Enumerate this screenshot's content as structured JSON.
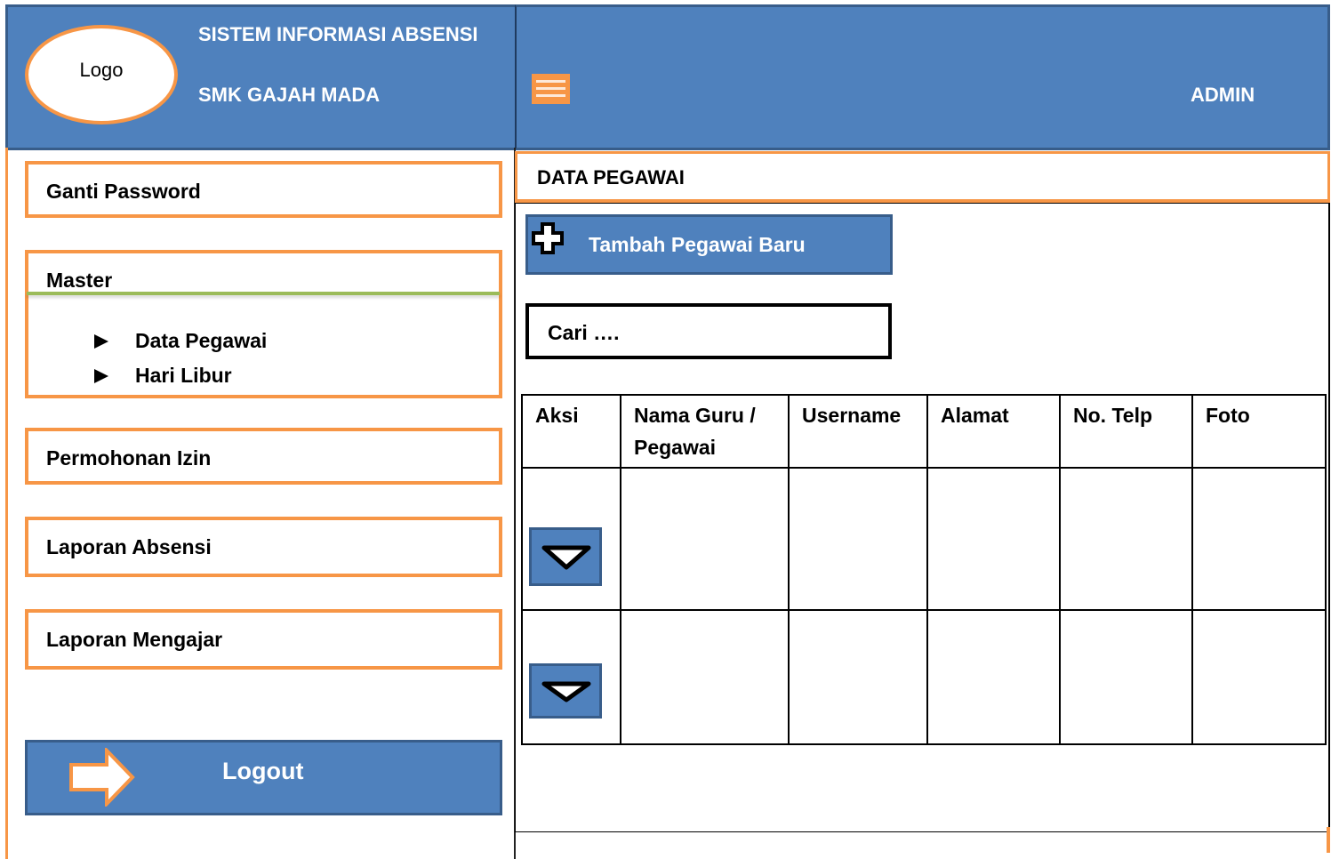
{
  "header": {
    "logo_text": "Logo",
    "system_title": "SISTEM INFORMASI ABSENSI",
    "school_name": "SMK GAJAH MADA",
    "menu_icon": "hamburger-icon",
    "user_label": "ADMIN"
  },
  "sidebar": {
    "ganti_password": "Ganti Password",
    "master": {
      "label": "Master",
      "items": [
        "Data Pegawai",
        "Hari Libur"
      ]
    },
    "permohonan_izin": "Permohonan Izin",
    "laporan_absensi": "Laporan Absensi",
    "laporan_mengajar": "Laporan Mengajar",
    "logout": {
      "label": "Logout",
      "icon": "arrow-right-icon"
    }
  },
  "main": {
    "section_title": "DATA PEGAWAI",
    "add_button": {
      "label": "Tambah Pegawai Baru",
      "icon": "plus-icon"
    },
    "search": {
      "placeholder": "Cari …."
    },
    "table": {
      "columns": [
        "Aksi",
        "Nama Guru / Pegawai",
        "Username",
        "Alamat",
        "No. Telp",
        "Foto"
      ],
      "rows": [
        {
          "action_icon": "chevron-down-icon",
          "cells": [
            "",
            "",
            "",
            "",
            ""
          ]
        },
        {
          "action_icon": "chevron-down-icon",
          "cells": [
            "",
            "",
            "",
            "",
            ""
          ]
        }
      ]
    }
  },
  "colors": {
    "header_blue": "#4f81bd",
    "border_blue": "#385d8a",
    "accent_orange": "#f79646",
    "divider_green": "#9bbb59"
  }
}
